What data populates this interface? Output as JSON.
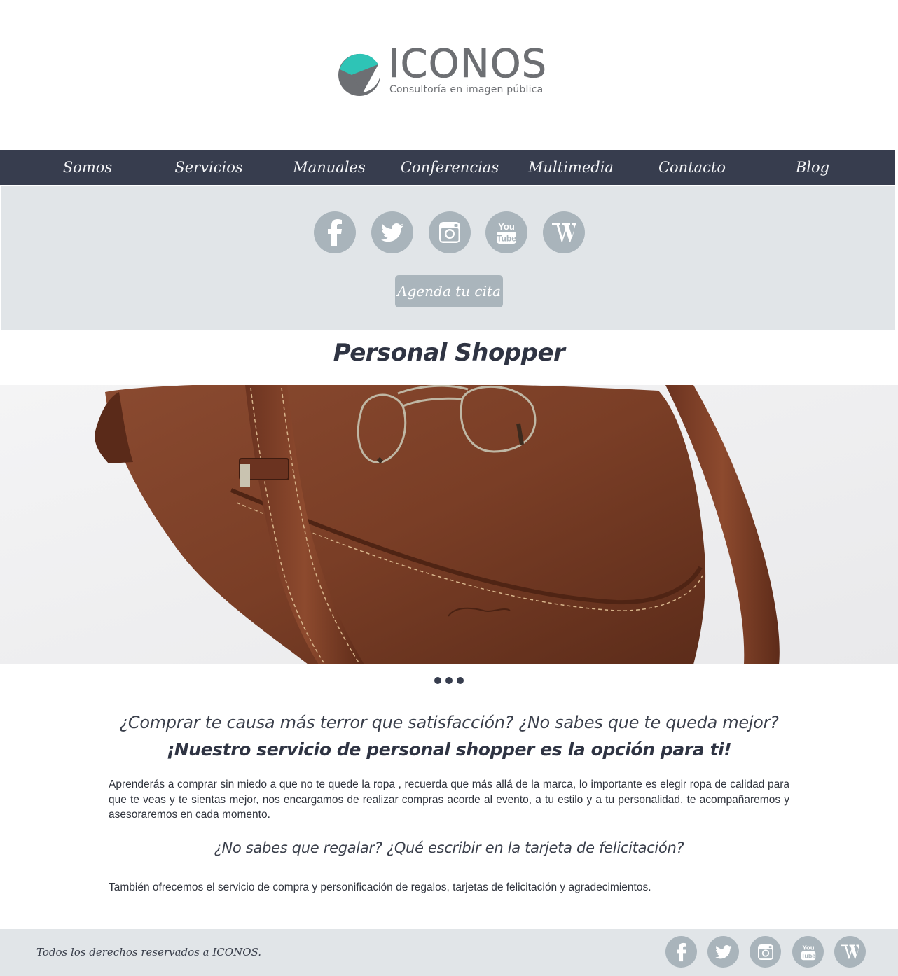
{
  "brand": {
    "name": "ICONOS",
    "tagline": "Consultoría en imagen pública",
    "colors": {
      "teal": "#2ec4b6",
      "gray": "#6d6f73",
      "nav": "#373d4e",
      "band": "#e1e5e8",
      "icon": "#a9b4bb"
    }
  },
  "nav": {
    "items": [
      {
        "label": "Somos"
      },
      {
        "label": "Servicios"
      },
      {
        "label": "Manuales"
      },
      {
        "label": "Conferencias"
      },
      {
        "label": "Multimedia"
      },
      {
        "label": "Contacto"
      },
      {
        "label": "Blog"
      }
    ]
  },
  "social": {
    "icons": [
      "facebook-icon",
      "twitter-icon",
      "instagram-icon",
      "youtube-icon",
      "wordpress-icon"
    ],
    "youtube_text_1": "You",
    "youtube_text_2": "Tube"
  },
  "cta": {
    "label": "Agenda tu cita"
  },
  "page": {
    "title": "Personal Shopper"
  },
  "carousel": {
    "slides": 3
  },
  "content": {
    "question_1": "¿Comprar te causa más terror que satisfacción? ¿No sabes que te queda mejor?",
    "headline_1": "¡Nuestro servicio de personal shopper es la opción para ti!",
    "paragraph_1": "Aprenderás a comprar sin miedo a que no te quede la ropa , recuerda que más allá de la marca, lo importante es elegir ropa de calidad para que te veas y te sientas mejor, nos encargamos de realizar compras acorde al evento, a tu estilo y a tu personalidad, te acompañaremos y asesoraremos en cada momento.",
    "question_2": "¿No sabes que regalar? ¿Qué escribir en la tarjeta de felicitación?",
    "paragraph_2": "También ofrecemos el servicio de compra y personificación de regalos, tarjetas de felicitación y agradecimientos."
  },
  "footer": {
    "copyright": "Todos los derechos reservados a ICONOS."
  }
}
